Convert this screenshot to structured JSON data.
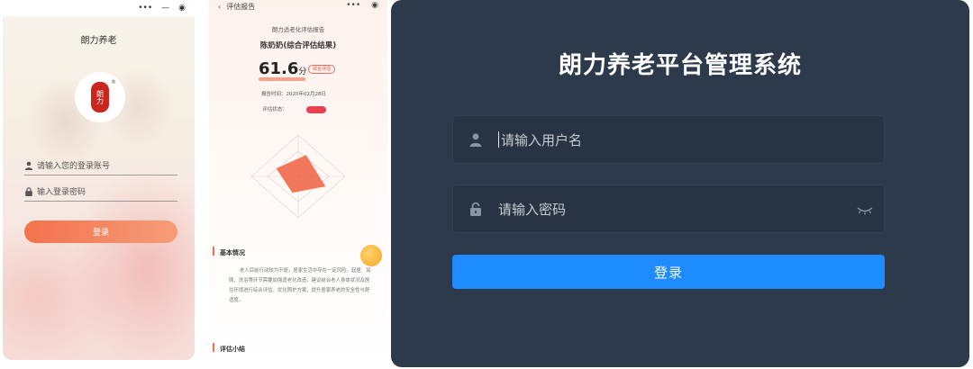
{
  "phone_login": {
    "status_icons": [
      "more-icon",
      "minimize-icon",
      "record-icon"
    ],
    "status_glyphs": [
      "•••",
      "—",
      "◉"
    ],
    "title": "朗力养老",
    "logo_text": "朗力",
    "logo_registered": "®",
    "account_placeholder": "请输入您的登录账号",
    "password_placeholder": "输入登录密码",
    "login_label": "登录",
    "accent": "#f3724d"
  },
  "phone_report": {
    "back_label": "‹",
    "header_title": "评估报告",
    "header_icons": [
      "more-icon",
      "record-icon"
    ],
    "header_glyphs": [
      "•••",
      "◉"
    ],
    "report_title": "朗力适老化评估报告",
    "subject_title": "陈奶奶(综合评估结果)",
    "score_value": "61.6",
    "score_unit": "分",
    "score_tag": "综合评估",
    "report_time": "报告时间：2020年02月28日",
    "status_label": "评估状态：",
    "status_color": "#e9414f",
    "radar_values": [
      0.55,
      0.62,
      0.42,
      0.5
    ],
    "radar_color": "#f0603f",
    "section_basic": "基本情况",
    "basic_text": "老人目前行动较为不便，居家生活中存在一定风险，起居、如厕、洗浴等环节需要加强适老化改造，建议结合老人身体状况及居住环境进行综合评估，优化照护方案，提升居家养老的安全性与舒适度。",
    "section_summary": "评估小结"
  },
  "admin": {
    "title": "朗力养老平台管理系统",
    "username_placeholder": "请输入用户名",
    "password_placeholder": "请输入密码",
    "login_label": "登录",
    "background": "#2d3a4b",
    "button_color": "#1e8bff"
  }
}
